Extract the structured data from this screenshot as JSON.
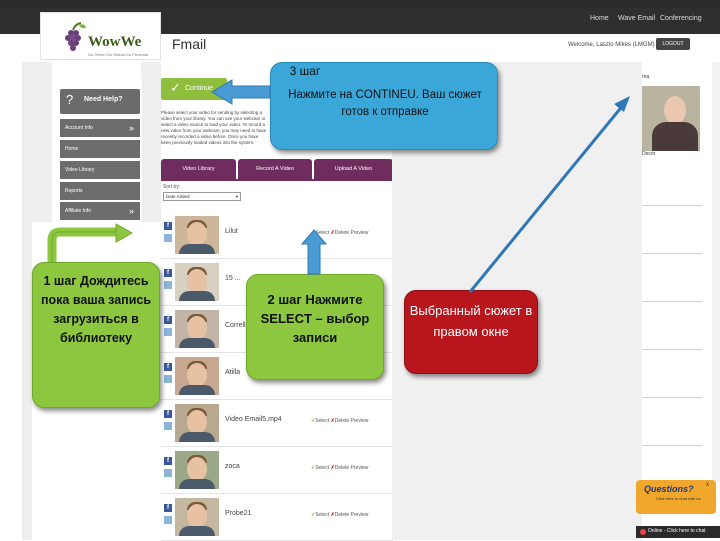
{
  "topnav": {
    "home": "Home",
    "wave_email": "Wave Email",
    "conferencing": "Conferencing"
  },
  "header": {
    "logo": "WowWe",
    "logo_tagline": "Go Green   Go Global   Go Personal",
    "page_title": "Fmail",
    "welcome": "Welcome, Laszlo Mikes (LMGM)",
    "logout": "LOGOUT"
  },
  "sidebar": {
    "need_help": "Need Help?",
    "items": [
      {
        "label": "Account Info",
        "has_chevron": true
      },
      {
        "label": "Home",
        "has_chevron": false
      },
      {
        "label": "Video Library",
        "has_chevron": false
      },
      {
        "label": "Reports",
        "has_chevron": false
      },
      {
        "label": "Affiliate Info",
        "has_chevron": true
      }
    ]
  },
  "compose": {
    "continue_label": "Continue",
    "instructions": "Please select your video for sending by selecting a video from your library. You can use your webcam or select a video source to load your video. To record a new video from your webcam, you may need to have recently recorded a video before. Once you have been previously loaded videos into the system."
  },
  "tabs": [
    "Video Library",
    "Record A Video",
    "Upload A Video"
  ],
  "sort": {
    "label": "Sort by:",
    "value": "Date Added"
  },
  "videos": [
    {
      "name": "Lilut",
      "select": "Select",
      "delete": "Delete",
      "preview": "Preview"
    },
    {
      "name": "15 ...",
      "select": "Select",
      "delete": "Delete",
      "preview": "Preview"
    },
    {
      "name": "Correll",
      "select": "Select",
      "delete": "Delete",
      "preview": "Preview"
    },
    {
      "name": "Atilla",
      "select": "Select",
      "delete": "Delete",
      "preview": "Preview"
    },
    {
      "name": "Video Email5.mp4",
      "select": "Select",
      "delete": "Delete",
      "preview": "Preview"
    },
    {
      "name": "zoca",
      "select": "Select",
      "delete": "Delete",
      "preview": "Preview"
    },
    {
      "name": "Probe21",
      "select": "Select",
      "delete": "Delete",
      "preview": "Preview"
    }
  ],
  "right_panel": {
    "top_label": "rna",
    "thumb_label": "Decor"
  },
  "questions": {
    "label": "Questions?",
    "sub": "Click here to chat with us",
    "close": "x"
  },
  "chat_bar": {
    "text": "Online - Click here to chat"
  },
  "callouts": {
    "step3_title": "3 шаг",
    "step3_text": "Нажмите на CONTINEU.  Ваш сюжет  готов к отправке",
    "step1_text": "1 шаг Дождитесь пока ваша запись загрузиться в библиотеку",
    "step2_text": "2 шаг Нажмите SELECT – выбор записи",
    "selected_text": "Выбранный сюжет в правом окне"
  },
  "colors": {
    "accent_green": "#8dc63f",
    "callout_blue": "#3aa7d8",
    "callout_red": "#b8151d",
    "tab_purple": "#6e2d5e",
    "continue_green": "#8fbd3d"
  }
}
